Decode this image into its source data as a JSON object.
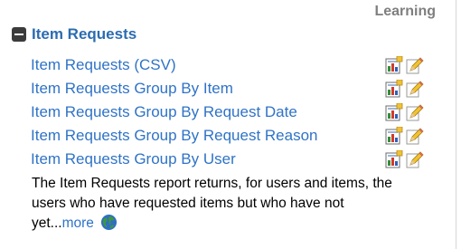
{
  "section": {
    "label": "Learning"
  },
  "group": {
    "title": "Item Requests"
  },
  "reports": [
    {
      "label": "Item Requests (CSV)"
    },
    {
      "label": "Item Requests Group By Item"
    },
    {
      "label": "Item Requests Group By Request Date"
    },
    {
      "label": "Item Requests Group By Request Reason"
    },
    {
      "label": "Item Requests Group By User"
    }
  ],
  "icons": {
    "row": [
      "report-chart-icon",
      "edit-pencil-icon"
    ],
    "collapse": "minus-box-icon",
    "more": "globe-icon"
  },
  "description": {
    "text": "The Item Requests report returns, for users and items, the users who have requested items but who have not yet...",
    "more_label": "more"
  },
  "colors": {
    "link": "#2f73c7",
    "title": "#2b6cb0",
    "label": "#7f7f7f"
  }
}
